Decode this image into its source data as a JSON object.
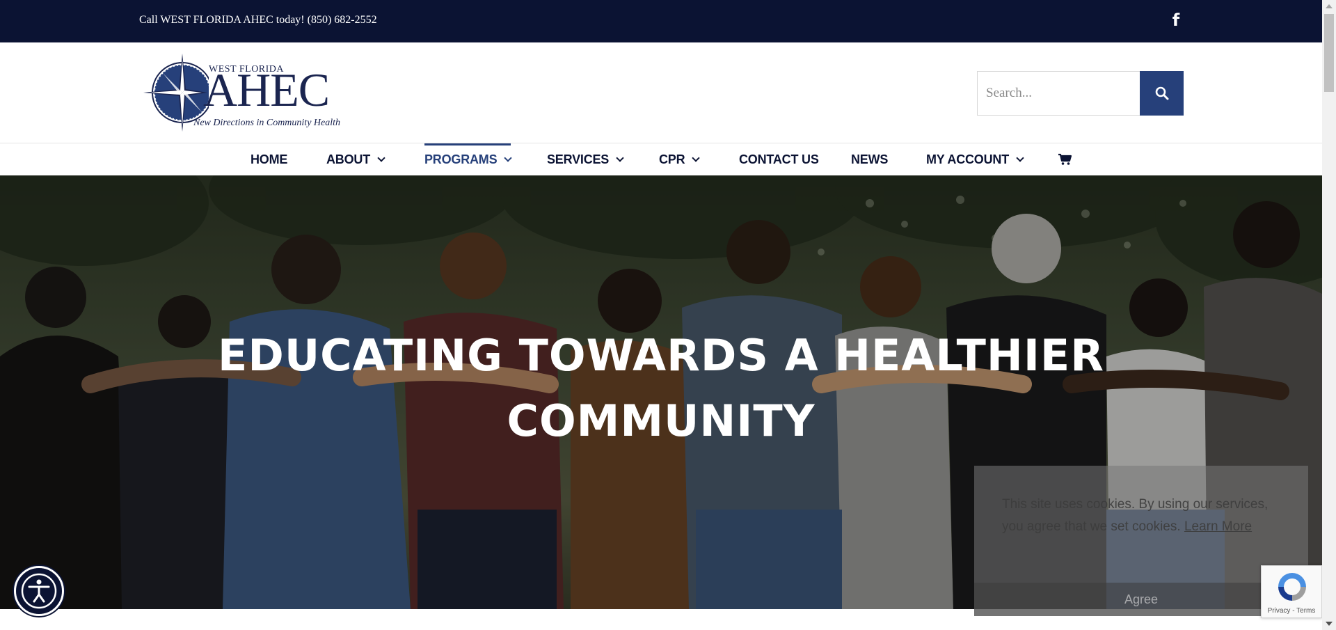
{
  "topbar": {
    "call_text": "Call WEST FLORIDA AHEC today! (850) 682-2552",
    "facebook_glyph": "f"
  },
  "logo": {
    "small_text": "WEST FLORIDA",
    "big_text": "AHEC",
    "tagline": "New Directions in Community Health"
  },
  "search": {
    "placeholder": "Search..."
  },
  "nav": {
    "items": [
      {
        "label": "HOME",
        "has_dropdown": false
      },
      {
        "label": "ABOUT",
        "has_dropdown": true
      },
      {
        "label": "PROGRAMS",
        "has_dropdown": true,
        "active": true
      },
      {
        "label": "SERVICES",
        "has_dropdown": true
      },
      {
        "label": "CPR",
        "has_dropdown": true
      },
      {
        "label": "CONTACT US",
        "has_dropdown": false
      },
      {
        "label": "NEWS",
        "has_dropdown": false
      },
      {
        "label": "MY ACCOUNT",
        "has_dropdown": true
      }
    ],
    "cart_icon": "cart-icon"
  },
  "hero": {
    "title_line1": "EDUCATING TOWARDS A HEALTHIER",
    "title_line2": "COMMUNITY"
  },
  "cookie": {
    "text": "This site uses cookies. By using our services, you agree that we set cookies.",
    "learn_more": "Learn More",
    "agree": "Agree"
  },
  "recaptcha": {
    "links": "Privacy - Terms"
  },
  "colors": {
    "navy": "#0b1333",
    "accent_blue": "#26407a"
  }
}
